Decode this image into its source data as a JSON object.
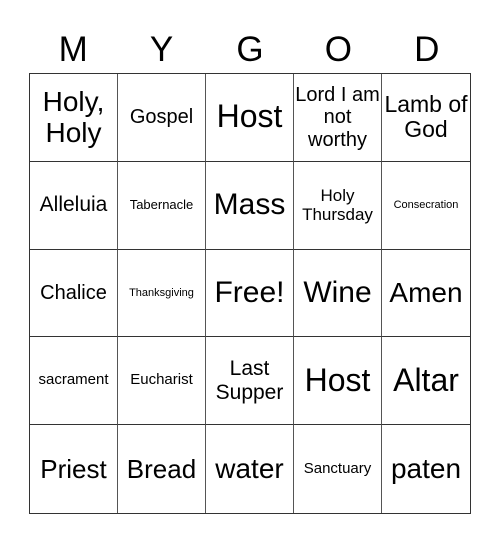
{
  "header": {
    "letters": [
      "M",
      "Y",
      "G",
      "O",
      "D"
    ]
  },
  "board": {
    "cells": [
      "Holy, Holy",
      "Gospel",
      "Host",
      "Lord I am not worthy",
      "Lamb of God",
      "Alleluia",
      "Tabernacle",
      "Mass",
      "Holy Thursday",
      "Consecration",
      "Chalice",
      "Thanksgiving",
      "Free!",
      "Wine",
      "Amen",
      "sacrament",
      "Eucharist",
      "Last Supper",
      "Host",
      "Altar",
      "Priest",
      "Bread",
      "water",
      "Sanctuary",
      "paten"
    ],
    "free_space_index": 12
  }
}
